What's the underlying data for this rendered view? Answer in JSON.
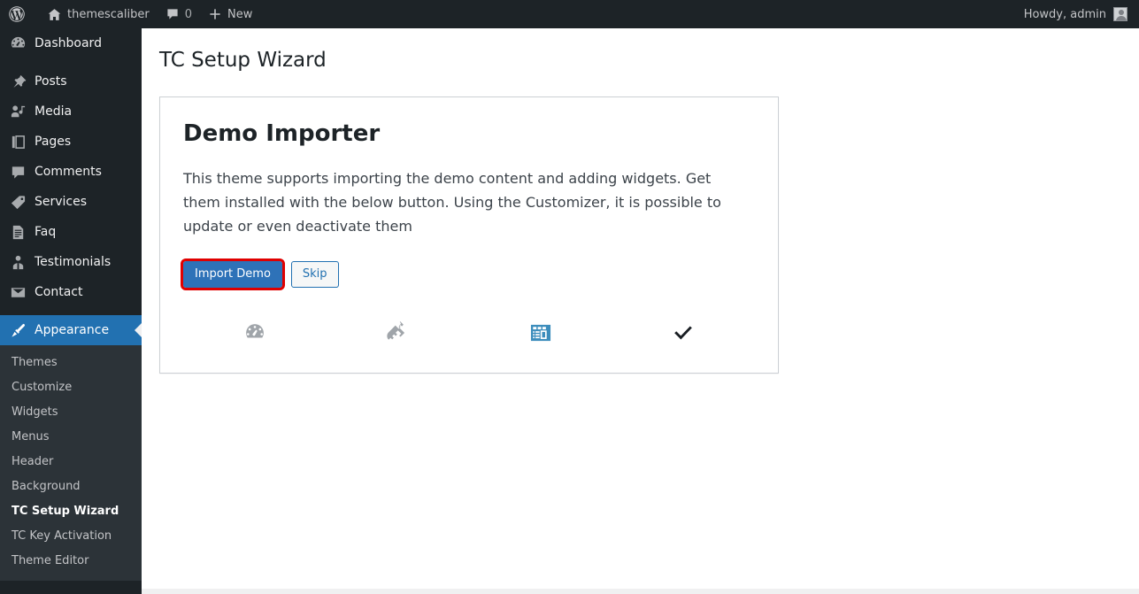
{
  "adminbar": {
    "logo_icon": "wordpress-logo-icon",
    "site_name": "themescaliber",
    "site_icon": "home-icon",
    "comments_icon": "comment-bubble-icon",
    "comments_count": "0",
    "new_icon": "plus-icon",
    "new_label": "New",
    "howdy": "Howdy, admin",
    "avatar_icon": "user-avatar-icon"
  },
  "sidebar": {
    "items": [
      {
        "label": "Dashboard",
        "icon": "dashboard-gauge-icon",
        "current": false
      },
      {
        "label": "Posts",
        "icon": "pin-icon",
        "current": false
      },
      {
        "label": "Media",
        "icon": "media-icon",
        "current": false
      },
      {
        "label": "Pages",
        "icon": "pages-icon",
        "current": false
      },
      {
        "label": "Comments",
        "icon": "comment-bubble-icon",
        "current": false
      },
      {
        "label": "Services",
        "icon": "tag-icon",
        "current": false
      },
      {
        "label": "Faq",
        "icon": "document-icon",
        "current": false
      },
      {
        "label": "Testimonials",
        "icon": "person-icon",
        "current": false
      },
      {
        "label": "Contact",
        "icon": "envelope-icon",
        "current": false
      },
      {
        "label": "Appearance",
        "icon": "paintbrush-icon",
        "current": true
      }
    ],
    "submenu": [
      {
        "label": "Themes",
        "current": false
      },
      {
        "label": "Customize",
        "current": false
      },
      {
        "label": "Widgets",
        "current": false
      },
      {
        "label": "Menus",
        "current": false
      },
      {
        "label": "Header",
        "current": false
      },
      {
        "label": "Background",
        "current": false
      },
      {
        "label": "TC Setup Wizard",
        "current": true
      },
      {
        "label": "TC Key Activation",
        "current": false
      },
      {
        "label": "Theme Editor",
        "current": false
      }
    ]
  },
  "main": {
    "page_title": "TC Setup Wizard",
    "card": {
      "heading": "Demo Importer",
      "body": "This theme supports importing the demo content and adding widgets. Get them installed with the below button. Using the Customizer, it is possible to update or even deactivate them",
      "primary_button": "Import Demo",
      "secondary_button": "Skip",
      "steps": [
        {
          "icon": "gauge-step-icon",
          "state": "done",
          "color": "#a0a5aa"
        },
        {
          "icon": "plug-step-icon",
          "state": "done",
          "color": "#a0a5aa"
        },
        {
          "icon": "layout-step-icon",
          "state": "active",
          "color": "#3c8dbc"
        },
        {
          "icon": "check-step-icon",
          "state": "pending",
          "color": "#191e23"
        }
      ]
    }
  },
  "colors": {
    "adminbar_bg": "#1d2327",
    "sidebar_bg": "#1d2327",
    "submenu_bg": "#2c3338",
    "accent_blue": "#2271b1",
    "primary_button_bg": "#2e72b8",
    "focus_ring": "#e00000",
    "step_active": "#3c8dbc",
    "step_inactive": "#a0a5aa"
  }
}
